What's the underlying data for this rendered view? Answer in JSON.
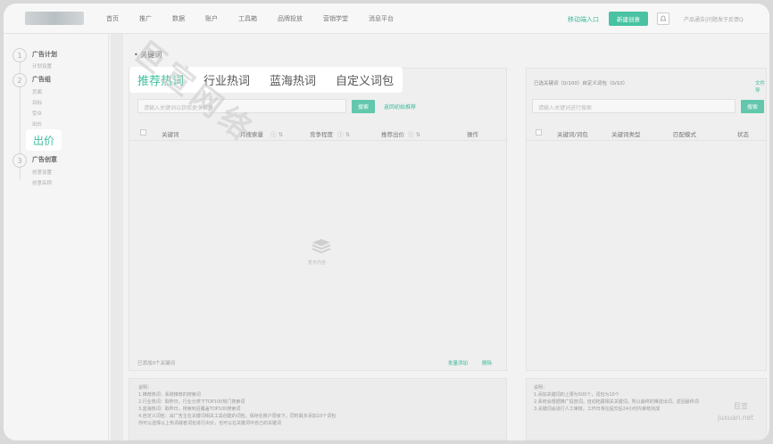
{
  "topbar": {
    "nav": [
      "首页",
      "推广",
      "数据",
      "账户",
      "工具箱",
      "品牌投放",
      "营销学堂",
      "消息平台"
    ],
    "mobile_link": "移动端入口",
    "new_button": "新建创意",
    "msg_icon": "bell-icon",
    "search_hint": "产品通告|问题发于反馈Q"
  },
  "sidebar": {
    "steps": [
      {
        "num": "1",
        "title": "广告计划",
        "subs": [
          "计划设置"
        ]
      },
      {
        "num": "2",
        "title": "广告组",
        "subs": [
          "页面",
          "目标",
          "受众",
          "出价"
        ]
      },
      {
        "num": "3",
        "title": "广告创意",
        "subs": [
          "创意设置",
          "创意名称"
        ]
      }
    ],
    "highlight": "出价"
  },
  "main": {
    "section_title": "• 关键词",
    "tabs": [
      "推荐热词",
      "行业热词",
      "蓝海热词",
      "自定义词包"
    ],
    "active_tab": 0,
    "input_placeholder": "请输入关键词以获取更多推荐",
    "search_btn": "搜索",
    "reset_link": "返回初始推荐",
    "columns": [
      "关键词",
      "月搜索量",
      "竞争程度",
      "推荐出价",
      "操作"
    ],
    "empty_text": "暂无内容",
    "footer_count": "已添加0个关键词",
    "footer_batch": "批量添加",
    "footer_delete": "删除"
  },
  "right": {
    "selected": "已选关键词（0/100）自定义词包（0/10）",
    "file_link": "文件导",
    "input_placeholder": "请输入关键词进行搜索",
    "search_btn": "搜索",
    "columns": [
      "关键词/词包",
      "关键词类型",
      "匹配模式",
      "状态"
    ]
  },
  "notes_left": {
    "title": "说明：",
    "lines": [
      "1.推荐热词：系统推荐的搜索词",
      "2.行业热词：取昨日，行业分类下TOP100热门搜索词",
      "3.蓝海热词：取昨日，搜索到且覆盖TOP100搜索词",
      "4.自定义词包：由广告主在关键词相关工具创建的词包，保存在账户层级下，同时最多添加10个词包",
      "你可以选择以上热词或者词包进行出价，也可以在关键词中自己的关键词"
    ]
  },
  "notes_right": {
    "title": "说明：",
    "lines": [
      "1.添加关键词的上限为500个，词包为10个",
      "2.系统会根据推广投放词，自动拓展相关关键词，所以最终的推送出词，返回最终词",
      "3.关键词会进行人工审核，工作日将在提交后24小时内审核完成"
    ]
  },
  "watermark": "巨宣网络",
  "brand": {
    "cn": "巨宣",
    "en": "juxuan.net"
  },
  "colors": {
    "accent": "#3dbf9e",
    "button": "#48c2a2"
  }
}
